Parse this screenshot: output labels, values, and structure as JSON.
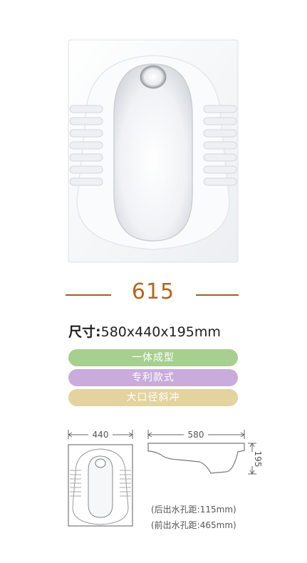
{
  "model": {
    "number": "615"
  },
  "size": {
    "label": "尺寸:",
    "value": "580x440x195mm"
  },
  "features": [
    "一体成型",
    "专利款式",
    "大口径斜冲"
  ],
  "drawing": {
    "width_dim": "440",
    "length_dim": "580",
    "height_dim": "195",
    "rear_outlet": "(后出水孔距:115mm)",
    "front_outlet": "(前出水孔距:465mm)"
  },
  "colors": {
    "accent": "#b6651f",
    "feature_1": "#a7cf8f",
    "feature_2": "#c9abdc",
    "feature_3": "#e4d39f"
  }
}
